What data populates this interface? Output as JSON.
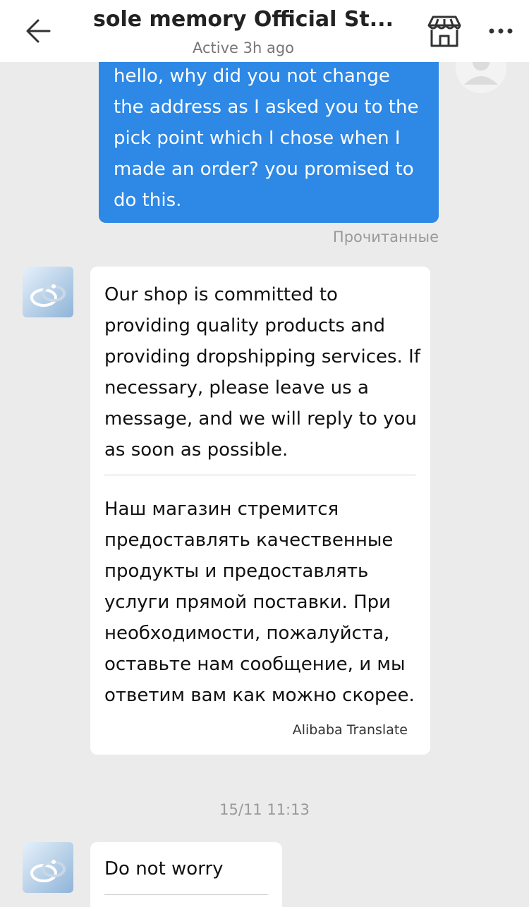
{
  "header": {
    "title": "sole memory Official St...",
    "status": "Active 3h ago",
    "back_icon": "arrow-left-icon",
    "store_icon": "store-icon",
    "more_icon": "more-horizontal-icon"
  },
  "colors": {
    "outgoing_bubble": "#2d88e6",
    "incoming_bubble": "#ffffff",
    "background": "#ebebeb"
  },
  "messages": [
    {
      "direction": "outgoing",
      "text": "hello, why did you not change the address as I asked you to the pick point which I chose when I made an order? you promised to do this.",
      "receipt": "Прочитанные"
    },
    {
      "direction": "incoming",
      "original": "Our shop is committed to providing quality products and providing dropshipping services. If necessary, please leave us a message, and we will reply to you as soon as possible.",
      "translation": "Наш магазин стремится предоставлять качественные продукты и предоставлять услуги прямой поставки. При необходимости, пожалуйста, оставьте нам сообщение, и мы ответим вам как можно скорее.",
      "translation_source": "Alibaba Translate"
    },
    {
      "direction": "incoming",
      "original": "Do not worry"
    }
  ],
  "timestamps": [
    "15/11 11:13"
  ]
}
